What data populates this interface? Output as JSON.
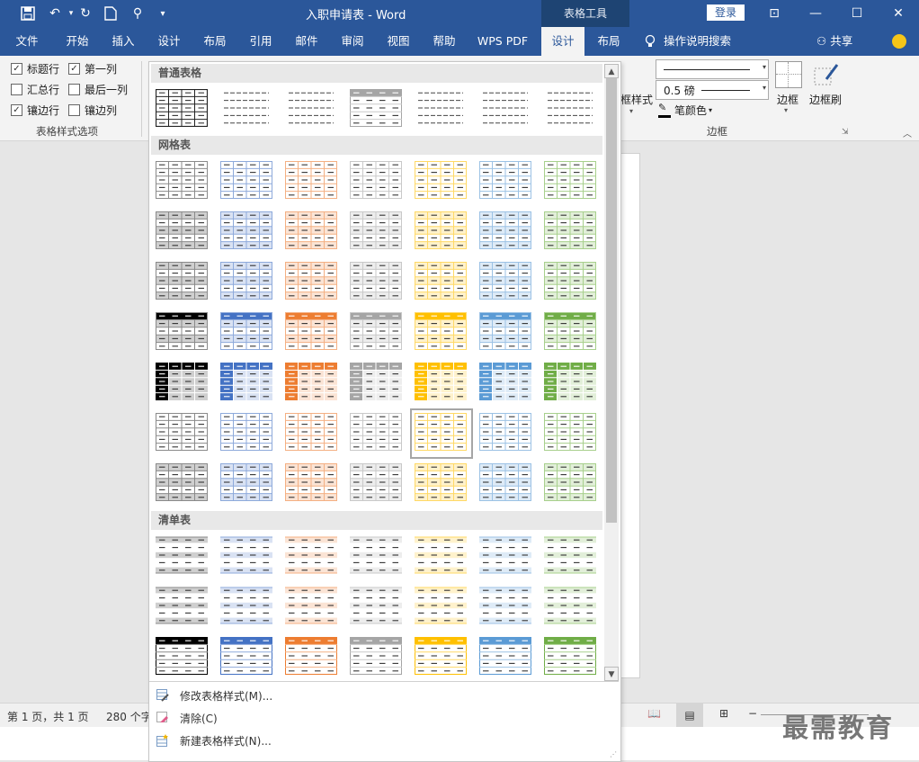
{
  "window": {
    "title": "入职申请表 - Word",
    "context_tab_group": "表格工具",
    "login": "登录",
    "buttons": {
      "ribbon_display": "⊡",
      "minimize": "—",
      "maximize": "☐",
      "close": "✕"
    }
  },
  "tabs": [
    "文件",
    "开始",
    "插入",
    "设计",
    "布局",
    "引用",
    "邮件",
    "审阅",
    "视图",
    "帮助",
    "WPS PDF",
    "设计",
    "布局"
  ],
  "active_tab_index": 11,
  "search_placeholder": "操作说明搜索",
  "share": "共享",
  "ribbon": {
    "options": [
      {
        "label": "标题行",
        "checked": true
      },
      {
        "label": "第一列",
        "checked": true
      },
      {
        "label": "汇总行",
        "checked": false
      },
      {
        "label": "最后一列",
        "checked": false
      },
      {
        "label": "镶边行",
        "checked": true
      },
      {
        "label": "镶边列",
        "checked": false
      }
    ],
    "options_group_label": "表格样式选项",
    "border_styles_label": "框样式",
    "pen_weight": "0.5 磅",
    "pen_color": "笔颜色",
    "borders_button": "边框",
    "border_painter": "边框刷",
    "borders_group_label": "边框"
  },
  "gallery": {
    "sections": [
      "普通表格",
      "网格表",
      "清单表"
    ],
    "menu": [
      "修改表格样式(M)...",
      "清除(C)",
      "新建表格样式(N)..."
    ],
    "colors": [
      "#000000",
      "#4472c4",
      "#ed7d31",
      "#a5a5a5",
      "#ffc000",
      "#5b9bd5",
      "#70ad47"
    ],
    "selected_style": "网格表 浅色 6 (金色)"
  },
  "status": {
    "page": "第 1 页，共 1 页",
    "words": "280 个字"
  },
  "watermark": "最需教育"
}
